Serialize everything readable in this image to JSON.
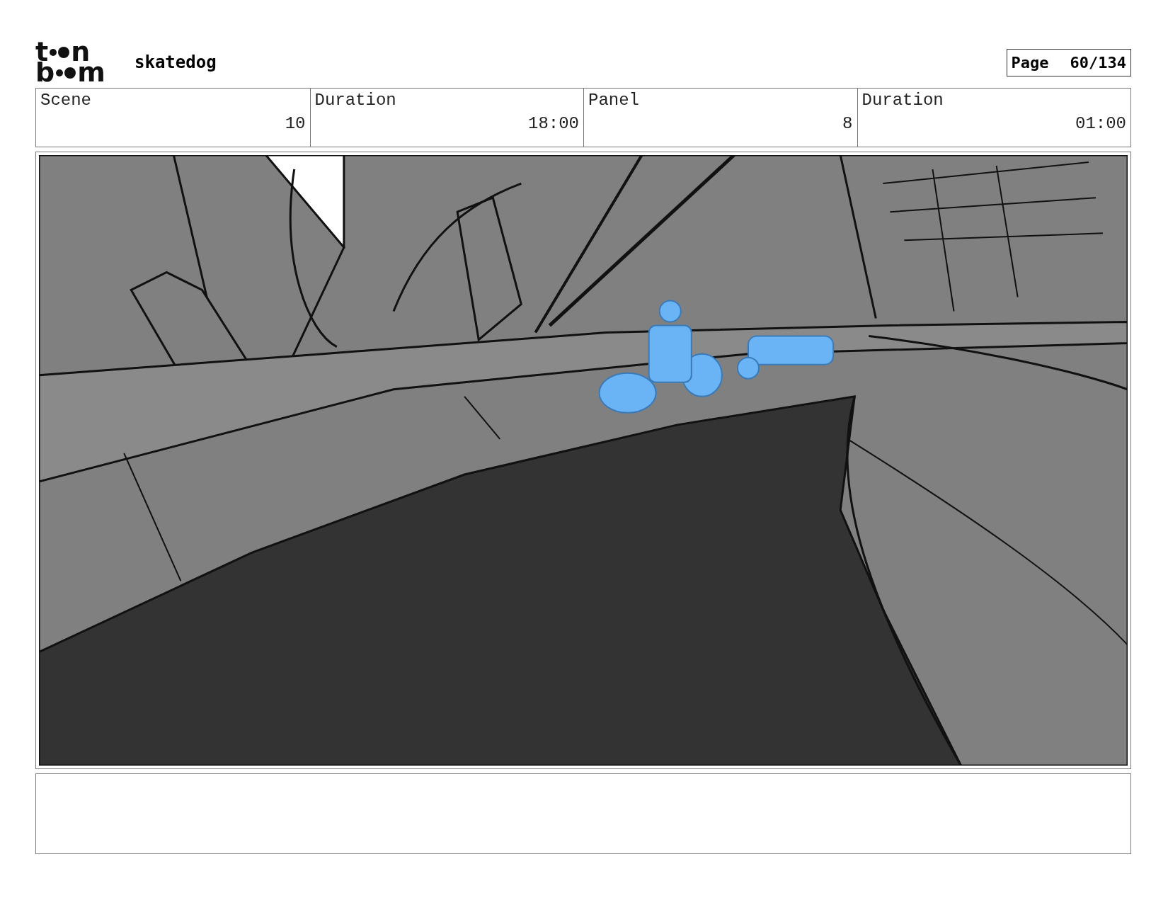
{
  "header": {
    "logo": {
      "top": [
        "t",
        "n"
      ],
      "bottom": [
        "b",
        "m"
      ]
    },
    "project": "skatedog",
    "page_label": "Page",
    "page_number": "60/134"
  },
  "info": {
    "labels": [
      "Scene",
      "Duration",
      "Panel",
      "Duration"
    ],
    "values": [
      "10",
      "18:00",
      "8",
      "01:00"
    ]
  }
}
